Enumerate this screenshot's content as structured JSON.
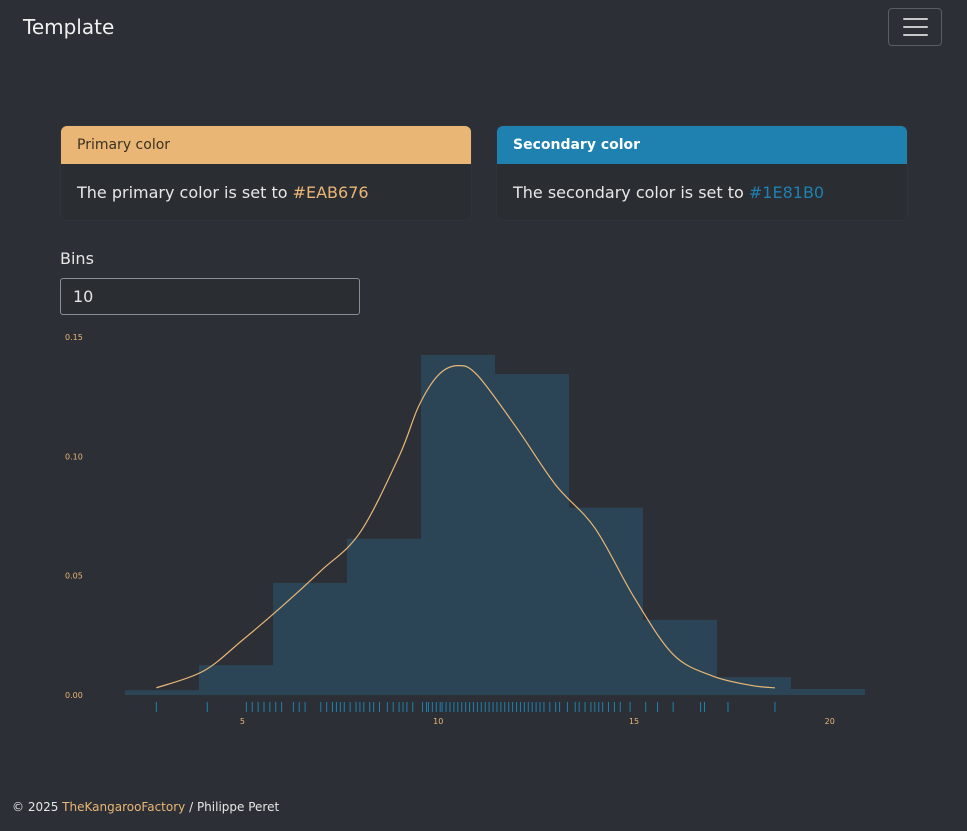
{
  "navbar": {
    "brand": "Template",
    "toggle_icon": "hamburger-menu-icon"
  },
  "cards": {
    "primary": {
      "header": "Primary color",
      "text": "The primary color is set to ",
      "value": "#EAB676"
    },
    "secondary": {
      "header": "Secondary color",
      "text": "The secondary color is set to ",
      "value": "#1E81B0"
    }
  },
  "bins": {
    "label": "Bins",
    "value": "10"
  },
  "chart_data": {
    "type": "bar",
    "title": "",
    "xlabel": "",
    "ylabel": "",
    "bin_edges": [
      2.0,
      3.89,
      5.78,
      7.67,
      9.56,
      11.45,
      13.34,
      15.23,
      17.12,
      19.01,
      20.9
    ],
    "values": [
      0.002,
      0.0125,
      0.047,
      0.0655,
      0.1425,
      0.1345,
      0.0785,
      0.0315,
      0.0075,
      0.0025
    ],
    "density_curve": {
      "x": [
        2.8,
        4,
        5,
        6,
        7,
        8,
        9,
        9.5,
        10,
        10.5,
        11,
        12,
        13,
        14,
        15,
        16,
        17,
        18,
        18.6
      ],
      "y": [
        0.003,
        0.01,
        0.023,
        0.037,
        0.052,
        0.068,
        0.1,
        0.121,
        0.134,
        0.138,
        0.134,
        0.112,
        0.088,
        0.07,
        0.041,
        0.017,
        0.008,
        0.004,
        0.003
      ]
    },
    "rug": [
      2.8,
      4.1,
      5.1,
      5.25,
      5.4,
      5.55,
      5.7,
      5.85,
      6.0,
      6.3,
      6.45,
      6.6,
      7.0,
      7.15,
      7.3,
      7.4,
      7.5,
      7.6,
      7.75,
      7.9,
      8.0,
      8.1,
      8.25,
      8.35,
      8.5,
      8.7,
      8.85,
      9.0,
      9.1,
      9.2,
      9.35,
      9.6,
      9.7,
      9.75,
      9.85,
      9.95,
      10.05,
      10.1,
      10.2,
      10.3,
      10.4,
      10.5,
      10.6,
      10.7,
      10.8,
      10.9,
      11.0,
      11.1,
      11.2,
      11.3,
      11.4,
      11.5,
      11.6,
      11.7,
      11.8,
      11.9,
      12.0,
      12.1,
      12.2,
      12.3,
      12.4,
      12.5,
      12.6,
      12.7,
      12.85,
      13.0,
      13.1,
      13.3,
      13.5,
      13.6,
      13.75,
      13.9,
      14.0,
      14.1,
      14.2,
      14.35,
      14.5,
      14.65,
      14.9,
      15.3,
      15.6,
      16.0,
      16.7,
      16.8,
      17.4,
      18.6
    ],
    "xticks": [
      5,
      10,
      15,
      20
    ],
    "yticks": [
      0.0,
      0.05,
      0.1,
      0.15
    ],
    "ytick_labels": [
      "0.00",
      "0.05",
      "0.10",
      "0.15"
    ],
    "xlim": [
      2.0,
      20.9
    ],
    "ylim": [
      0,
      0.15
    ],
    "grid": false,
    "bar_color": "#2C4556",
    "curve_color": "#EAB676",
    "rug_color": "#1E81B0"
  },
  "footer": {
    "copyright": "© 2025 ",
    "link": "TheKangarooFactory",
    "suffix": " / Philippe Peret"
  }
}
